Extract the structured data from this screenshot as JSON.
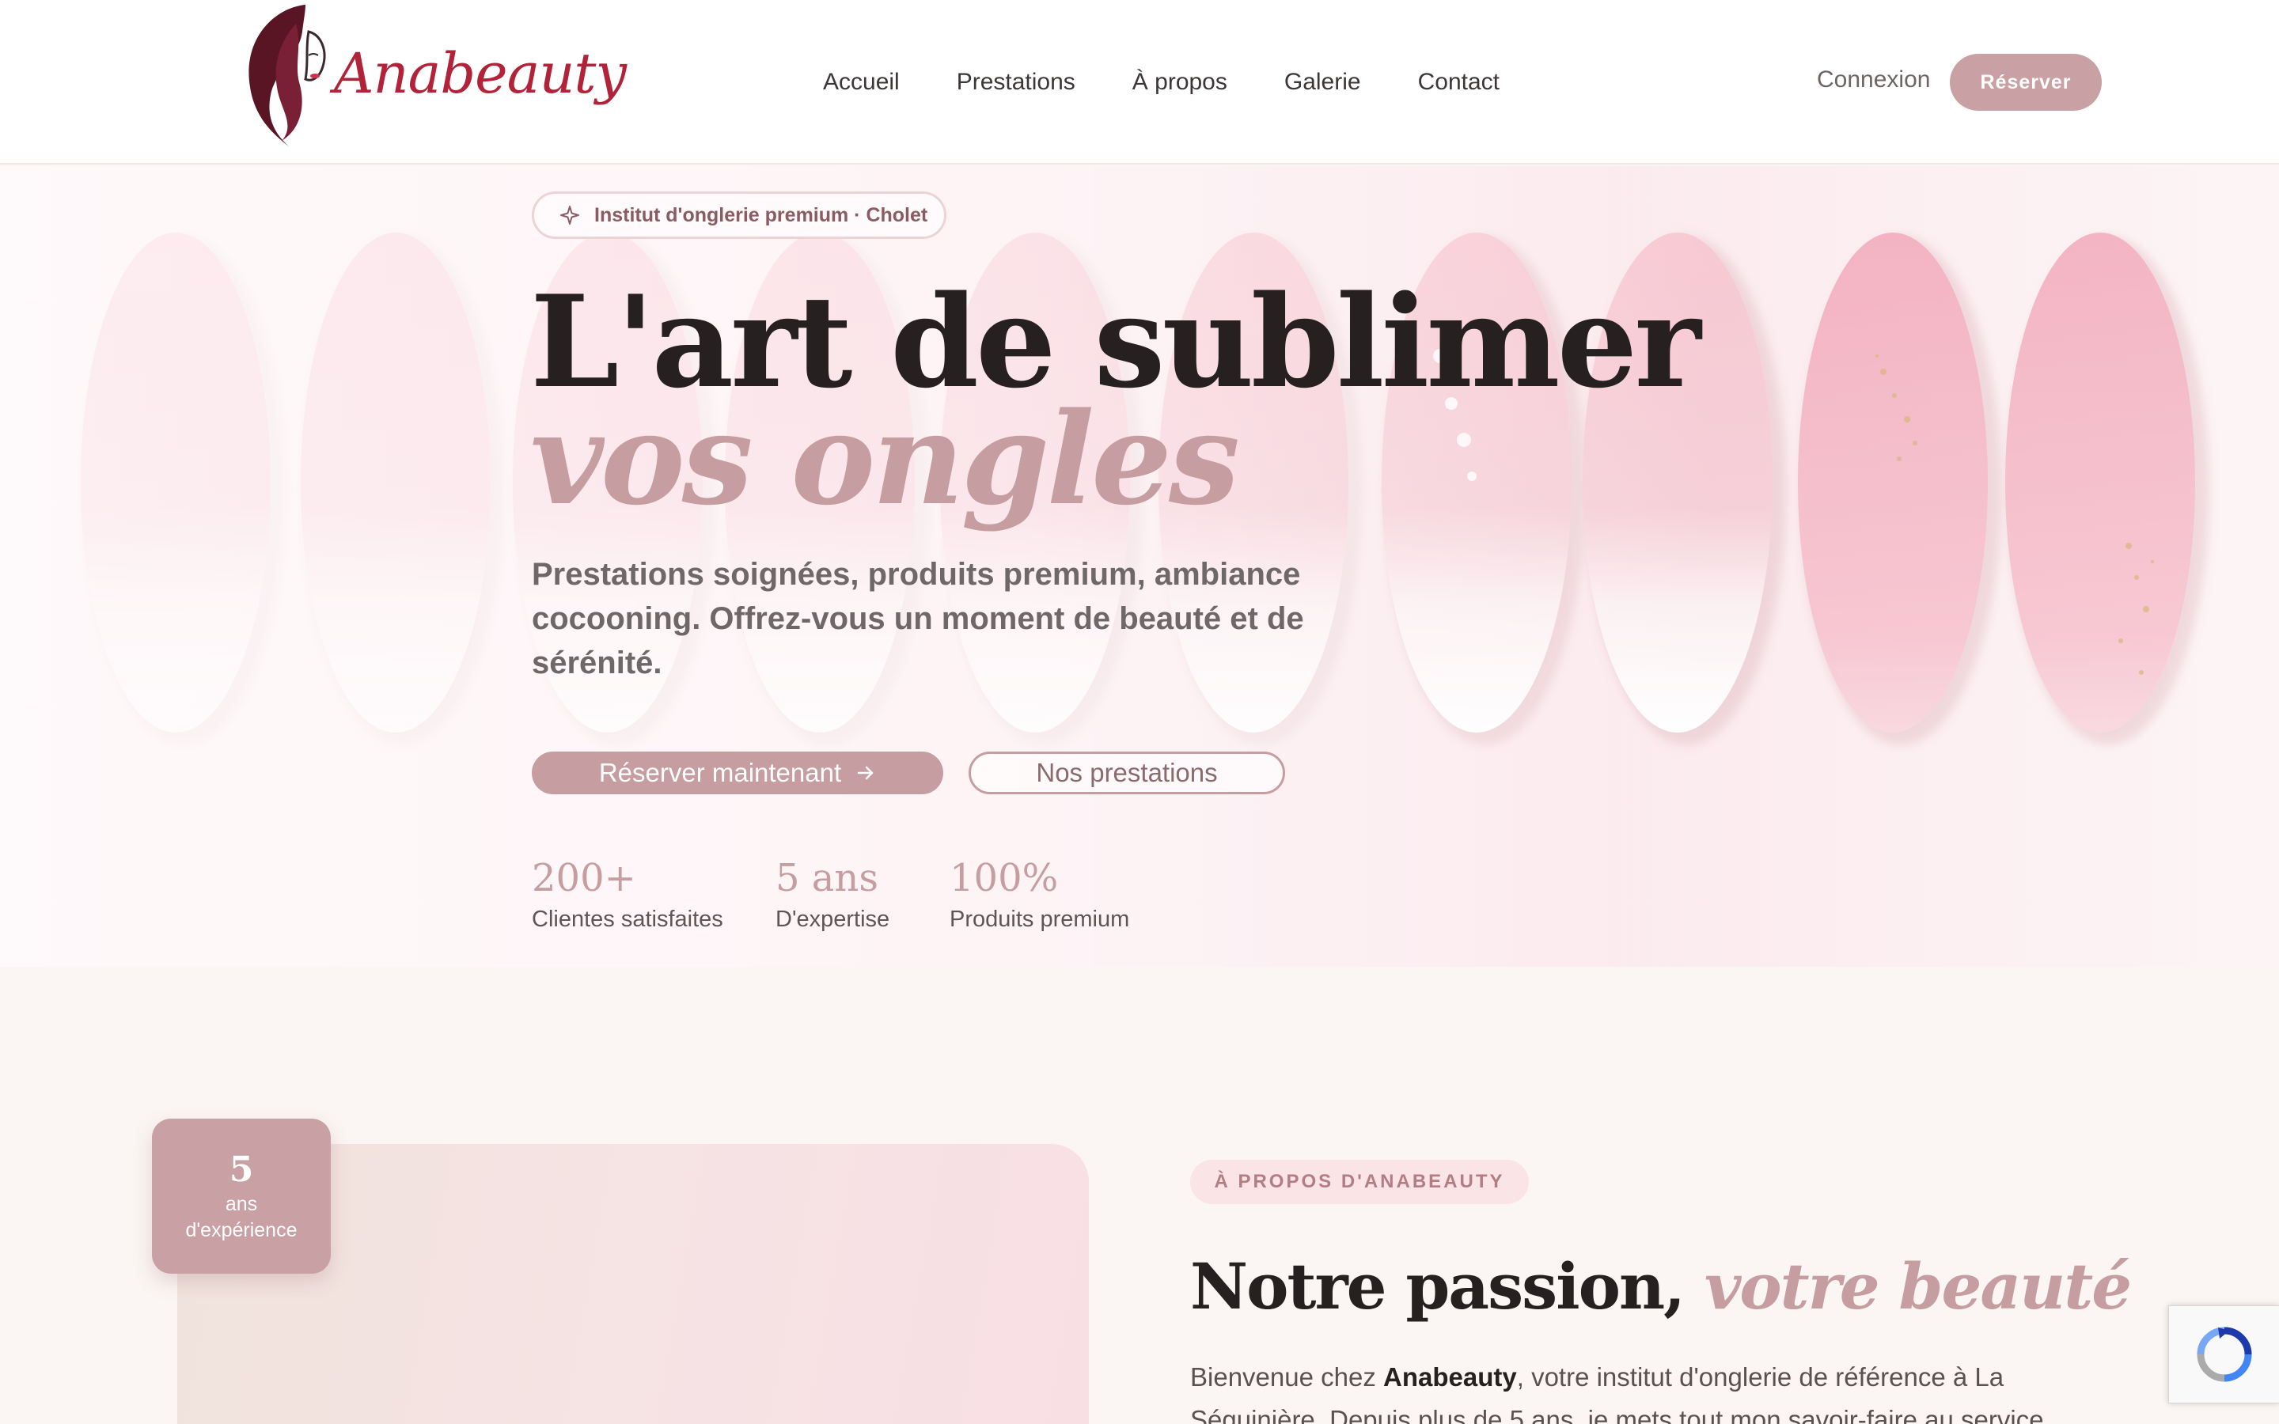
{
  "header": {
    "logo_text": "Anabeauty",
    "nav": [
      "Accueil",
      "Prestations",
      "À propos",
      "Galerie",
      "Contact"
    ],
    "login": "Connexion",
    "book": "Réserver"
  },
  "hero": {
    "badge": "Institut d'onglerie premium · Cholet",
    "title_main": "L'art de sublimer ",
    "title_accent": "vos ongles",
    "subtitle": "Prestations soignées, produits premium, ambiance cocooning. Offrez-vous un moment de beauté et de sérénité.",
    "cta_primary": "Réserver maintenant",
    "cta_secondary": "Nos prestations",
    "stats": [
      {
        "value": "200+",
        "label": "Clientes satisfaites"
      },
      {
        "value": "5 ans",
        "label": "D'expertise"
      },
      {
        "value": "100%",
        "label": "Produits premium"
      }
    ]
  },
  "about": {
    "experience_number": "5",
    "experience_unit": "ans",
    "experience_label": "d'expérience",
    "tag": "À PROPOS D'ANABEAUTY",
    "title_main": "Notre passion, ",
    "title_accent": "votre beauté",
    "text_before": "Bienvenue chez ",
    "text_brand": "Anabeauty",
    "text_after": ", votre institut d'onglerie de référence à La Séguinière. Depuis plus de 5 ans, je mets tout mon savoir-faire au service"
  },
  "colors": {
    "accent": "#c69da1",
    "button": "#c9a0a3",
    "logo_red": "#b2233a",
    "logo_dark": "#5a1524",
    "text_dark": "#262020"
  },
  "icons": {
    "badge": "sparkle-icon",
    "cta": "arrow-right-icon",
    "captcha": "recaptcha-icon"
  }
}
